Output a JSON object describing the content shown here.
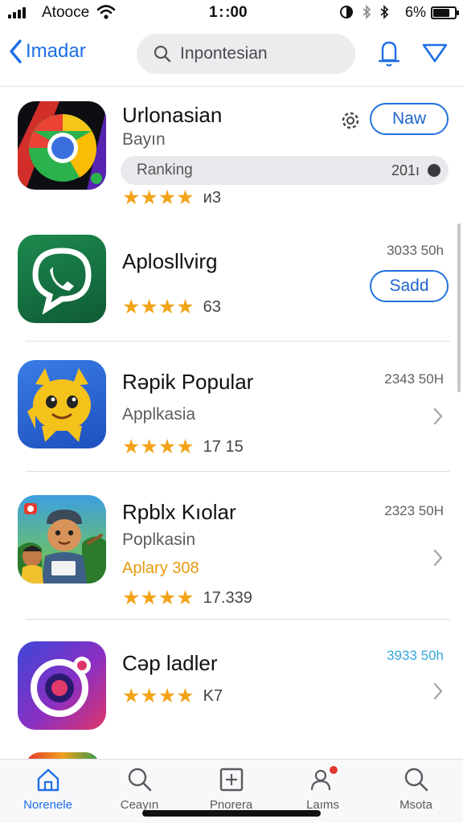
{
  "status": {
    "carrier": "Atooce",
    "time": "1 : :00",
    "battery": "6%"
  },
  "nav": {
    "back_label": "Imadar",
    "search_placeholder": "Inpontesian"
  },
  "apps": [
    {
      "name": "Urlonasian",
      "subtitle": "Bayın",
      "ranking_label": "Ranking",
      "ranking_value": "201ı",
      "stars": "★★★★",
      "count": "и3",
      "action": "Naw",
      "icon": "chrome-like-icon"
    },
    {
      "name": "Aplosllvirg",
      "size": "3033 50h",
      "stars": "★★★★",
      "count": "63",
      "action": "Sadd",
      "icon": "phone-chat-icon"
    },
    {
      "name": "Rəpik Popular",
      "subtitle": "Applkasia",
      "size": "2343 50H",
      "stars": "★★★★",
      "count": "17  15",
      "icon": "cat-mascot-icon"
    },
    {
      "name": "Rpblx Kıolar",
      "subtitle": "Poplkasin",
      "highlight": "Aplary 308",
      "size": "2323 50H",
      "stars": "★★★★",
      "count": "17.339",
      "icon": "game-character-icon"
    },
    {
      "name": "Cəp ladler",
      "size": "3933 50h",
      "stars": "★★★★",
      "count": "K7",
      "icon": "camera-lens-icon"
    }
  ],
  "tabs": [
    {
      "label": "Norenele",
      "icon": "home-icon",
      "active": true
    },
    {
      "label": "Ceayın",
      "icon": "search-icon"
    },
    {
      "label": "Ρnorera",
      "icon": "add-box-icon"
    },
    {
      "label": "Laıms",
      "icon": "people-icon"
    },
    {
      "label": "Msota",
      "icon": "magnifier-icon"
    }
  ],
  "colors": {
    "accent": "#1e6fe6",
    "star": "#f3a318",
    "highlight": "#e69a10"
  }
}
